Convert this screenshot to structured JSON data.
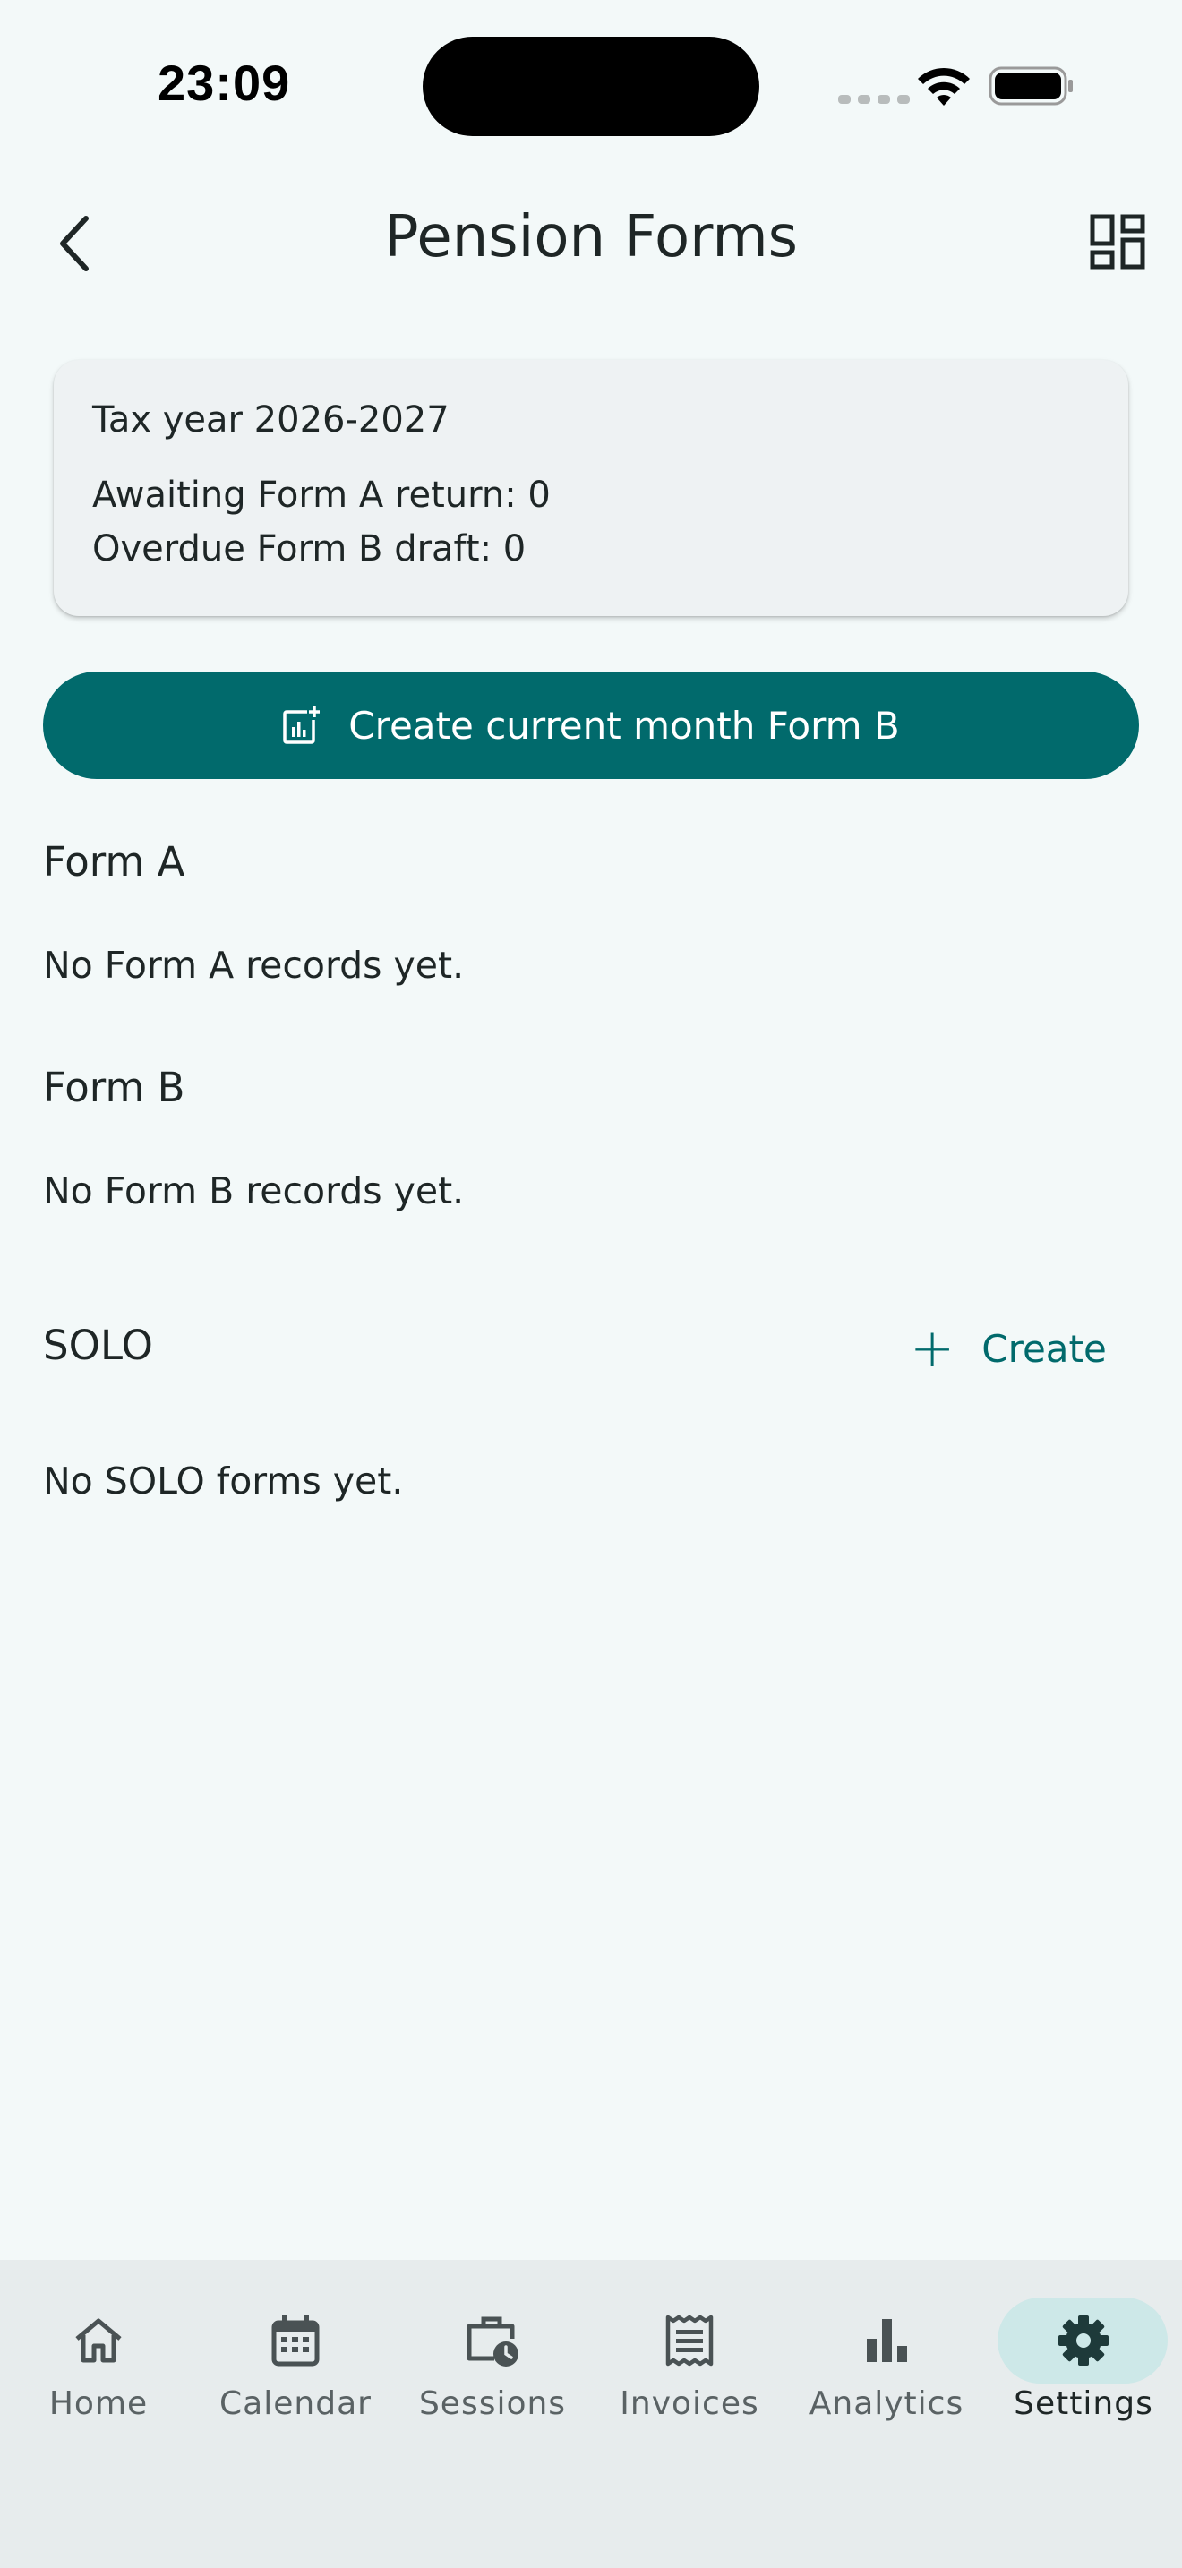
{
  "status_bar": {
    "time": "23:09"
  },
  "header": {
    "title": "Pension Forms"
  },
  "summary_card": {
    "tax_year": "Tax year 2026-2027",
    "awaiting_form_a": "Awaiting Form A return: 0",
    "overdue_form_b": "Overdue Form B draft: 0"
  },
  "primary_action": {
    "label": "Create current month Form B"
  },
  "sections": {
    "form_a": {
      "title": "Form A",
      "empty": "No Form A records yet."
    },
    "form_b": {
      "title": "Form B",
      "empty": "No Form B records yet."
    },
    "solo": {
      "title": "SOLO",
      "create_label": "Create",
      "empty": "No SOLO forms yet."
    }
  },
  "bottom_nav": {
    "items": [
      {
        "label": "Home",
        "icon": "home-icon"
      },
      {
        "label": "Calendar",
        "icon": "calendar-icon"
      },
      {
        "label": "Sessions",
        "icon": "briefcase-clock-icon"
      },
      {
        "label": "Invoices",
        "icon": "receipt-icon"
      },
      {
        "label": "Analytics",
        "icon": "bar-chart-icon"
      },
      {
        "label": "Settings",
        "icon": "gear-icon"
      }
    ],
    "active": "Settings"
  },
  "colors": {
    "accent": "#016a6c",
    "background": "#f3f9f9",
    "nav_background": "#e7eced",
    "active_pill": "#cde8e8"
  }
}
